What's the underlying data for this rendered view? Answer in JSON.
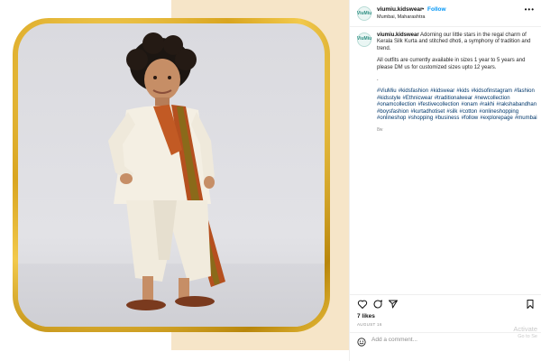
{
  "post": {
    "username": "viumiu.kidswear",
    "follow_label": "Follow",
    "separator": "•",
    "location": "Mumbai, Maharashtra",
    "more_label": "•••",
    "avatar_text": "ViuMiu"
  },
  "caption": {
    "username": "viumiu.kidswear",
    "text1": "Adorning our little stars in the regal charm of Kerala Silk Kurta and stitched dhoti, a symphony of tradition and trend.",
    "text2": "All outfits are currently available in sizes 1 year to 5 years and please DM us for customized sizes upto 12 years.",
    "dot": ".",
    "hashtags": "#ViuMiu #kidsfashion #kidswear #kids #kidsofinstagram #fashion #kidsstyle #Ethnicwear #traditionalwear #newcollection #onamcollection #festivecollection #onam #rakhi #rakshabandhan #boysfashion #kurtadhotiset #silk #cotton #onlineshopping #onlineshop #shopping #business #follow #explorepage #mumbai",
    "age": "8w"
  },
  "actions": {
    "icons": [
      "heart-icon",
      "comment-icon",
      "share-icon",
      "bookmark-icon"
    ]
  },
  "likes": "7 likes",
  "date": "AUGUST 16",
  "comment_box": {
    "placeholder": "Add a comment..."
  },
  "watermark": {
    "line1": "Activate",
    "line2": "Go to Se"
  },
  "colors": {
    "accent": "#0095f6",
    "gold": "#d9a520",
    "cream": "#f6e5c8"
  }
}
